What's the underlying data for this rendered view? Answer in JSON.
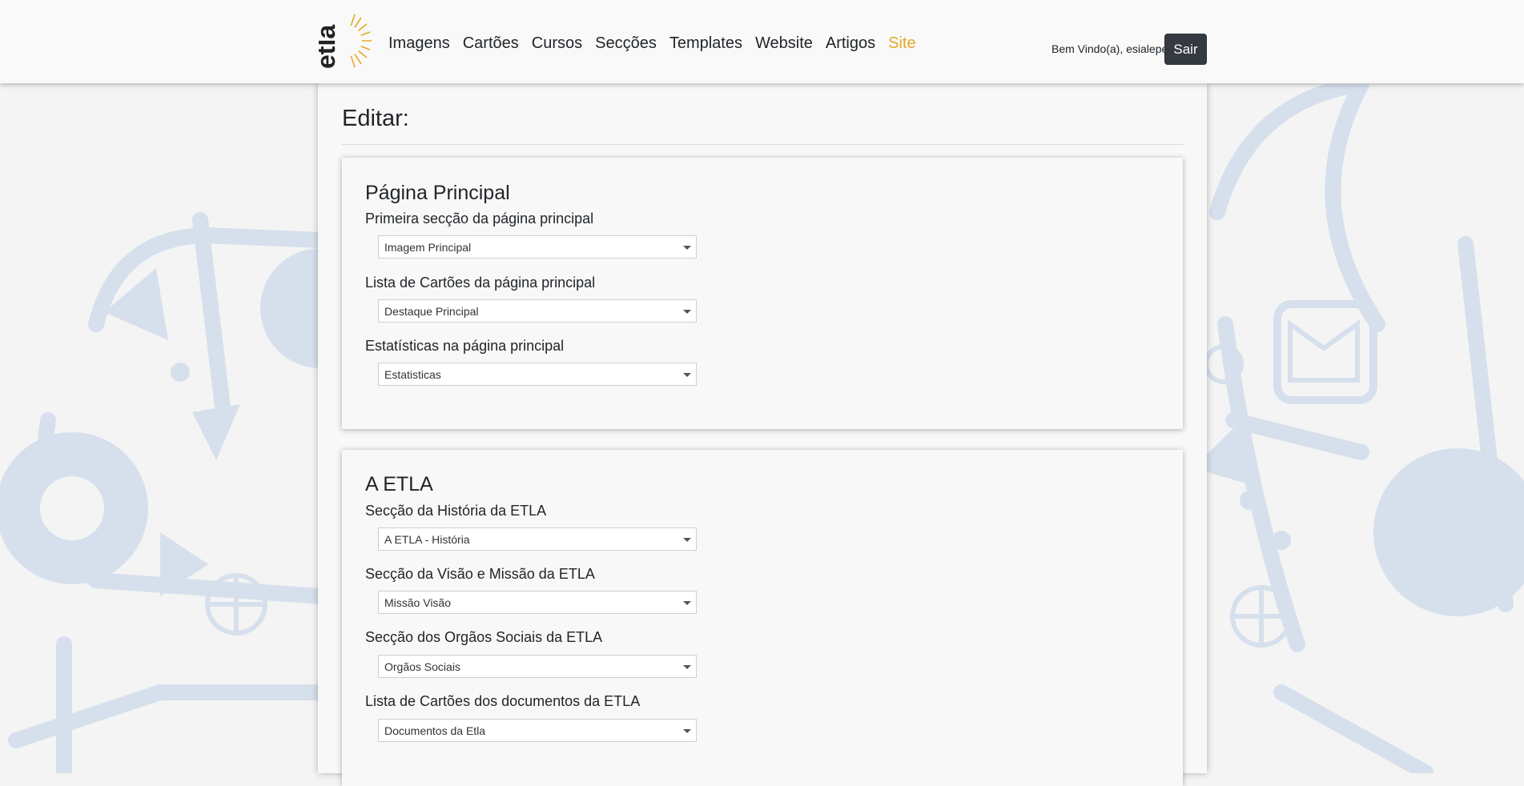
{
  "header": {
    "logo_text": "etla",
    "nav": [
      {
        "label": "Imagens"
      },
      {
        "label": "Cartões"
      },
      {
        "label": "Cursos"
      },
      {
        "label": "Secções"
      },
      {
        "label": "Templates"
      },
      {
        "label": "Website"
      },
      {
        "label": "Artigos"
      },
      {
        "label": "Site",
        "active": true
      }
    ],
    "welcome": "Bem Vindo(a), esialepe",
    "logout_label": "Sair"
  },
  "page": {
    "title": "Editar:"
  },
  "sections": [
    {
      "title": "Página Principal",
      "fields": [
        {
          "label": "Primeira secção da página principal",
          "value": "Imagem Principal"
        },
        {
          "label": "Lista de Cartões da página principal",
          "value": "Destaque Principal"
        },
        {
          "label": "Estatísticas na página principal",
          "value": "Estatisticas"
        }
      ]
    },
    {
      "title": "A ETLA",
      "fields": [
        {
          "label": "Secção da História da ETLA",
          "value": "A ETLA - História"
        },
        {
          "label": "Secção da Visão e Missão da ETLA",
          "value": "Missão Visão"
        },
        {
          "label": "Secção dos Orgãos Sociais da ETLA",
          "value": "Orgãos Sociais"
        },
        {
          "label": "Lista de Cartões dos documentos da ETLA",
          "value": "Documentos da Etla"
        }
      ]
    }
  ],
  "colors": {
    "accent": "#e5a82a",
    "button_dark": "#343a40",
    "background_pattern": "#d6e0ec"
  }
}
